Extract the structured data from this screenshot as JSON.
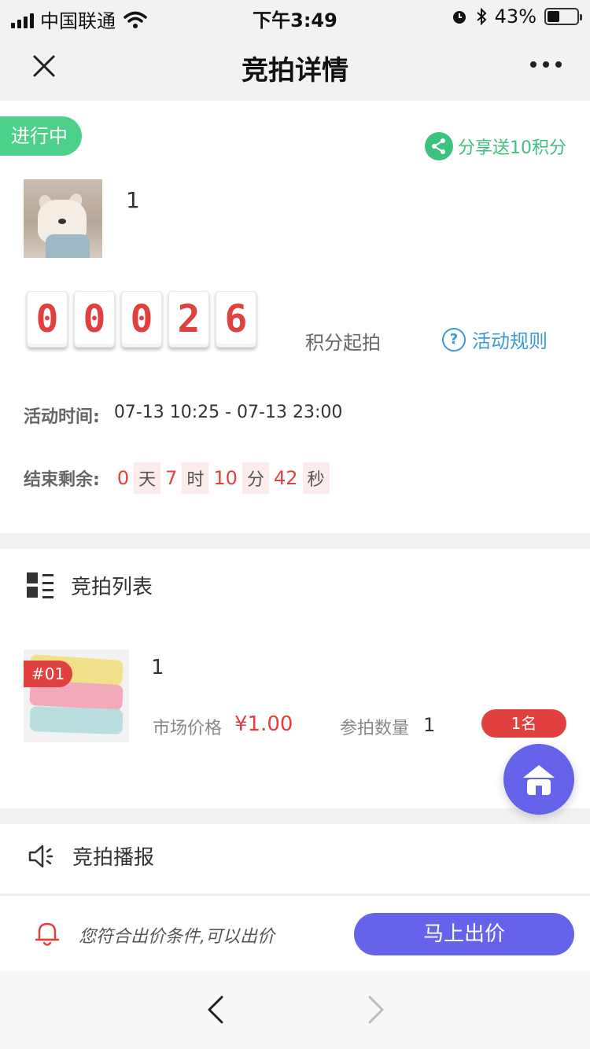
{
  "status_bar": {
    "carrier": "中国联通",
    "time": "下午3:49",
    "battery": "43%",
    "battery_level": 0.43
  },
  "nav": {
    "title": "竞拍详情",
    "close_icon": "close-icon",
    "more_icon": "more-dots-icon"
  },
  "auction": {
    "status_tag": "进行中",
    "share_label": "分享送10积分",
    "share_icon": "share-icon",
    "item_name": "1",
    "start_points_digits": [
      "0",
      "0",
      "0",
      "2",
      "6"
    ],
    "start_points_label": "积分起拍",
    "rules_label": "活动规则",
    "rules_icon": "question-circle-icon",
    "activity_time_label": "活动时间:",
    "activity_time_value": "07-13 10:25 - 07-13 23:00",
    "remaining_label": "结束剩余:",
    "remaining": {
      "days": "0",
      "days_unit": "天",
      "hours": "7",
      "hours_unit": "时",
      "minutes": "10",
      "minutes_unit": "分",
      "seconds": "42",
      "seconds_unit": "秒"
    }
  },
  "bid_list": {
    "title": "竞拍列表",
    "icon": "list-icon",
    "items": [
      {
        "rank_badge": "#01",
        "name": "1",
        "market_price_label": "市场价格",
        "market_price": "¥1.00",
        "bid_count_label": "参拍数量",
        "bid_count": "1",
        "place": "1名"
      }
    ]
  },
  "broadcast": {
    "title": "竞拍播报",
    "icon": "speaker-icon"
  },
  "bottom": {
    "eligibility_text": "您符合出价条件,可以出价",
    "bid_button": "马上出价"
  },
  "colors": {
    "accent": "#6563ea",
    "status_green": "#4cd08a",
    "red": "#e0413e",
    "link_blue": "#3a9ad9"
  }
}
